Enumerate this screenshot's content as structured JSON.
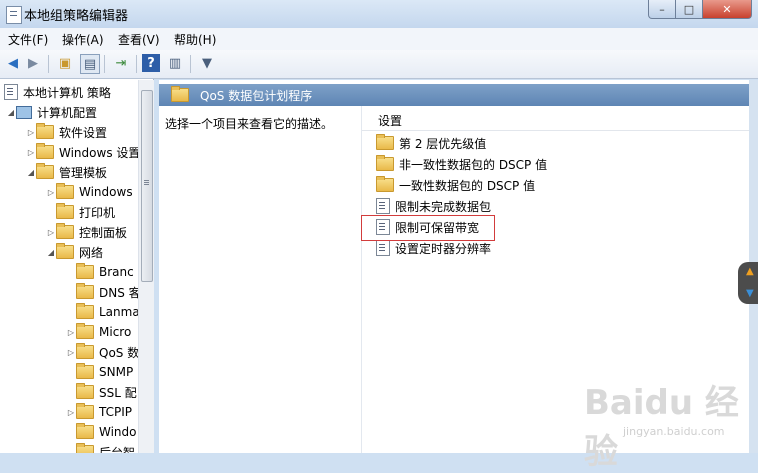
{
  "window": {
    "title": "本地组策略编辑器",
    "min_label": "–",
    "max_label": "□",
    "close_label": "✕"
  },
  "menu": [
    {
      "label": "文件(F)"
    },
    {
      "label": "操作(A)"
    },
    {
      "label": "查看(V)"
    },
    {
      "label": "帮助(H)"
    }
  ],
  "toolbar": {
    "icons": [
      "back-arrow-icon",
      "forward-arrow-icon",
      "up-folder-icon",
      "show-hide-tree-icon",
      "export-list-icon",
      "help-icon",
      "extended-view-icon",
      "filter-icon"
    ]
  },
  "tree": {
    "items": [
      {
        "label": "本地计算机 策略"
      },
      {
        "label": "计算机配置"
      },
      {
        "label": "软件设置"
      },
      {
        "label": "Windows 设置"
      },
      {
        "label": "管理模板"
      },
      {
        "label": "Windows"
      },
      {
        "label": "打印机"
      },
      {
        "label": "控制面板"
      },
      {
        "label": "网络"
      },
      {
        "label": "Branc"
      },
      {
        "label": "DNS 客"
      },
      {
        "label": "Lanma"
      },
      {
        "label": "Micro"
      },
      {
        "label": "QoS 数"
      },
      {
        "label": "SNMP"
      },
      {
        "label": "SSL 配"
      },
      {
        "label": "TCPIP"
      },
      {
        "label": "Windo"
      },
      {
        "label": "后台智"
      }
    ]
  },
  "content": {
    "header_title": "QoS 数据包计划程序",
    "description": "选择一个项目来查看它的描述。",
    "column_header": "设置",
    "items": [
      {
        "label": "第 2 层优先级值",
        "type": "folder"
      },
      {
        "label": "非一致性数据包的 DSCP 值",
        "type": "folder"
      },
      {
        "label": "一致性数据包的 DSCP 值",
        "type": "folder"
      },
      {
        "label": "限制未完成数据包",
        "type": "setting"
      },
      {
        "label": "限制可保留带宽",
        "type": "setting"
      },
      {
        "label": "设置定时器分辨率",
        "type": "setting"
      }
    ]
  },
  "watermark": {
    "text": "Baidu 经验",
    "sub": "jingyan.baidu.com"
  },
  "colors": {
    "header_bg": "#6a8fbe",
    "highlight_border": "#d23c3c"
  }
}
